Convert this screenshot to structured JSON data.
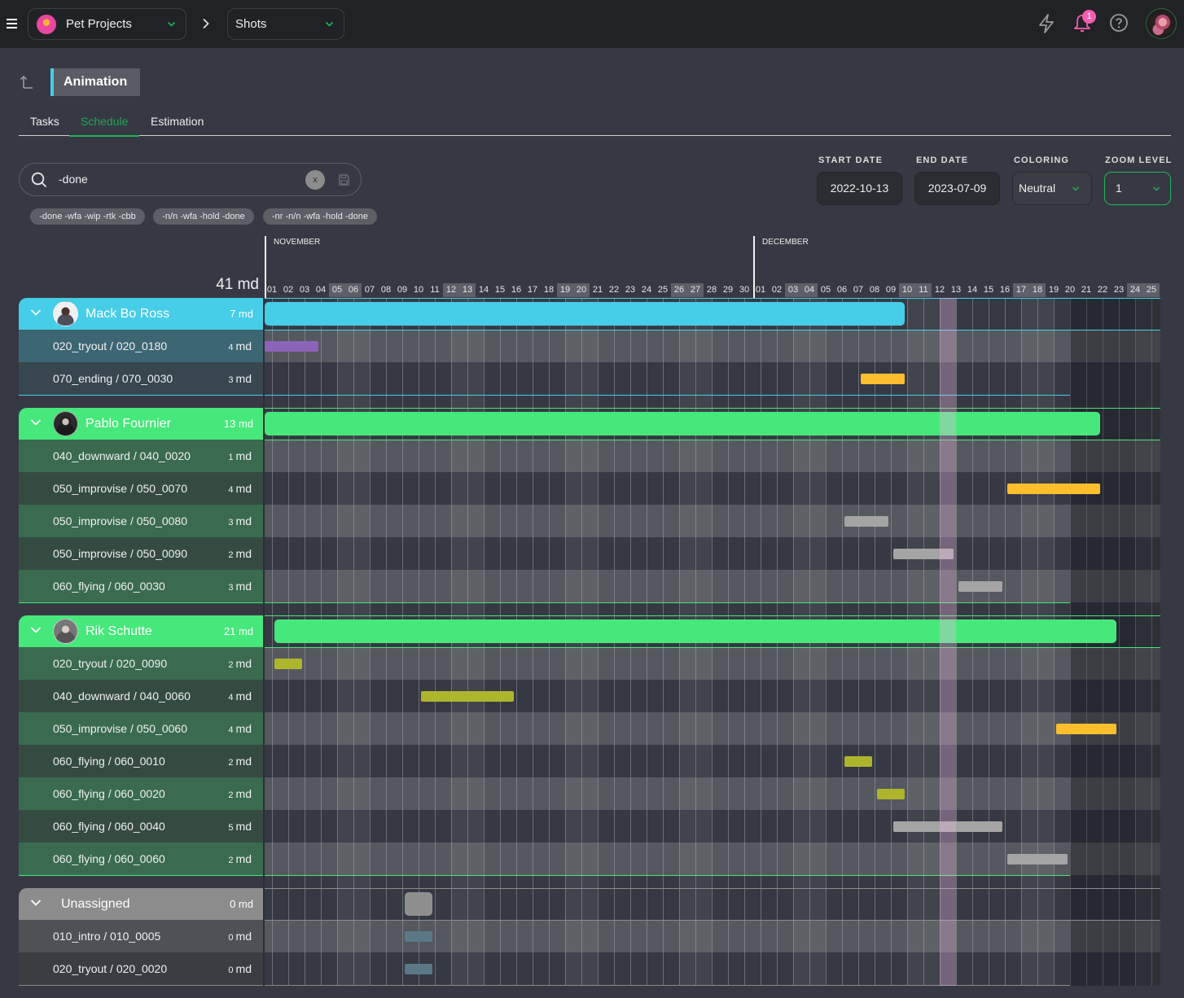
{
  "topbar": {
    "project": {
      "label": "Pet Projects"
    },
    "section": {
      "label": "Shots"
    },
    "notifications": {
      "count": "1"
    }
  },
  "page": {
    "title": "Animation"
  },
  "tabs": [
    {
      "label": "Tasks",
      "active": false
    },
    {
      "label": "Schedule",
      "active": true
    },
    {
      "label": "Estimation",
      "active": false
    }
  ],
  "search": {
    "value": "-done",
    "clear_label": "x"
  },
  "filter_pills": [
    "-done -wfa -wip -rtk -cbb",
    "-n/n -wfa -hold -done",
    "-nr -n/n -wfa -hold -done"
  ],
  "filters": {
    "start_date": {
      "label": "START DATE",
      "value": "2022-10-13"
    },
    "end_date": {
      "label": "END DATE",
      "value": "2023-07-09"
    },
    "coloring": {
      "label": "COLORING",
      "value": "Neutral"
    },
    "zoom_level": {
      "label": "ZOOM LEVEL",
      "value": "1"
    }
  },
  "colors": {
    "accent_green": "#22b35a",
    "notification_pink": "#f25db0",
    "group_row_light_grid": "#55585e",
    "group_row_dark_grid": "#36383f"
  },
  "schedule": {
    "total_md": "41 md",
    "timeline": {
      "first_day": "2022-11-01",
      "today": "2022-12-12",
      "shaded_from": "2022-12-20",
      "months": [
        {
          "name": "NOVEMBER",
          "days": [
            "01",
            "02",
            "03",
            "04",
            "05",
            "06",
            "07",
            "08",
            "09",
            "10",
            "11",
            "12",
            "13",
            "14",
            "15",
            "16",
            "17",
            "18",
            "19",
            "20",
            "21",
            "22",
            "23",
            "24",
            "25",
            "26",
            "27",
            "28",
            "29",
            "30"
          ],
          "weekend_days": [
            "05",
            "06",
            "12",
            "13",
            "19",
            "20",
            "26",
            "27"
          ]
        },
        {
          "name": "DECEMBER",
          "days": [
            "01",
            "02",
            "03",
            "04",
            "05",
            "06",
            "07",
            "08",
            "09",
            "10",
            "11",
            "12",
            "13",
            "14",
            "15",
            "16",
            "17",
            "18",
            "19",
            "20",
            "21",
            "22",
            "23",
            "24",
            "25"
          ],
          "weekend_days": [
            "03",
            "04",
            "10",
            "11",
            "17",
            "18",
            "24",
            "25"
          ]
        }
      ]
    },
    "groups": [
      {
        "name": "Mack Bo Ross",
        "md": "7 md",
        "has_avatar": true,
        "color": "#46cde8",
        "row_light": "#3d6673",
        "row_dark": "#37464f",
        "bar": {
          "starts_before_view": true,
          "start": null,
          "end": "2022-12-09"
        },
        "tasks": [
          {
            "label": "020_tryout / 020_0180",
            "md_value": "4",
            "md_unit": "md",
            "bar": {
              "starts_before_view": true,
              "start": null,
              "end": "2022-11-03",
              "color": "#8b63b8"
            }
          },
          {
            "label": "070_ending / 070_0030",
            "md_value": "3",
            "md_unit": "md",
            "bar": {
              "start": "2022-12-07",
              "end": "2022-12-09",
              "color": "#fbbf2e"
            }
          }
        ]
      },
      {
        "name": "Pablo Fournier",
        "md": "13 md",
        "has_avatar": true,
        "color": "#46e87b",
        "row_light": "#3a6b4e",
        "row_dark": "#354b42",
        "bar": {
          "starts_before_view": true,
          "start": null,
          "end": "2022-12-21"
        },
        "tasks": [
          {
            "label": "040_downward / 040_0020",
            "md_value": "1",
            "md_unit": "md",
            "bar": null
          },
          {
            "label": "050_improvise / 050_0070",
            "md_value": "4",
            "md_unit": "md",
            "bar": {
              "start": "2022-12-16",
              "end": "2022-12-21",
              "color": "#fbbf2e"
            }
          },
          {
            "label": "050_improvise / 050_0080",
            "md_value": "3",
            "md_unit": "md",
            "bar": {
              "start": "2022-12-06",
              "end": "2022-12-08",
              "color": "#a4a4a4"
            }
          },
          {
            "label": "050_improvise / 050_0090",
            "md_value": "2",
            "md_unit": "md",
            "bar": {
              "start": "2022-12-09",
              "end": "2022-12-12",
              "color": "#a4a4a4"
            }
          },
          {
            "label": "060_flying / 060_0030",
            "md_value": "3",
            "md_unit": "md",
            "bar": {
              "start": "2022-12-13",
              "end": "2022-12-15",
              "color": "#a4a4a4"
            }
          }
        ]
      },
      {
        "name": "Rik Schutte",
        "md": "21 md",
        "has_avatar": true,
        "color": "#46e87b",
        "row_light": "#3a6b4e",
        "row_dark": "#354b42",
        "bar": {
          "start": "2022-11-01",
          "end": "2022-12-22"
        },
        "tasks": [
          {
            "label": "020_tryout / 020_0090",
            "md_value": "2",
            "md_unit": "md",
            "bar": {
              "start": "2022-11-01",
              "end": "2022-11-02",
              "color": "#aeb52d"
            }
          },
          {
            "label": "040_downward / 040_0060",
            "md_value": "4",
            "md_unit": "md",
            "bar": {
              "start": "2022-11-10",
              "end": "2022-11-15",
              "color": "#aeb52d"
            }
          },
          {
            "label": "050_improvise / 050_0060",
            "md_value": "4",
            "md_unit": "md",
            "bar": {
              "start": "2022-12-19",
              "end": "2022-12-22",
              "color": "#fbbf2e"
            }
          },
          {
            "label": "060_flying / 060_0010",
            "md_value": "2",
            "md_unit": "md",
            "bar": {
              "start": "2022-12-06",
              "end": "2022-12-07",
              "color": "#aeb52d"
            }
          },
          {
            "label": "060_flying / 060_0020",
            "md_value": "2",
            "md_unit": "md",
            "bar": {
              "start": "2022-12-08",
              "end": "2022-12-09",
              "color": "#aeb52d"
            }
          },
          {
            "label": "060_flying / 060_0040",
            "md_value": "5",
            "md_unit": "md",
            "bar": {
              "start": "2022-12-09",
              "end": "2022-12-15",
              "color": "#a4a4a4"
            }
          },
          {
            "label": "060_flying / 060_0060",
            "md_value": "2",
            "md_unit": "md",
            "bar": {
              "start": "2022-12-16",
              "end": "2022-12-19",
              "color": "#a4a4a4"
            }
          }
        ]
      },
      {
        "name": "Unassigned",
        "md": "0 md",
        "has_avatar": false,
        "color": "#8c8c8c",
        "row_light": "#4f5157",
        "row_dark": "#3b3d43",
        "bar": {
          "start": "2022-11-09",
          "end": "2022-11-10",
          "color": "#8e8e8e"
        },
        "tasks": [
          {
            "label": "010_intro / 010_0005",
            "md_value": "0",
            "md_unit": "md",
            "bar": {
              "start": "2022-11-09",
              "end": "2022-11-10",
              "color": "#5b7887"
            }
          },
          {
            "label": "020_tryout / 020_0020",
            "md_value": "0",
            "md_unit": "md",
            "bar": {
              "start": "2022-11-09",
              "end": "2022-11-10",
              "color": "#5b7887"
            }
          }
        ]
      }
    ]
  }
}
